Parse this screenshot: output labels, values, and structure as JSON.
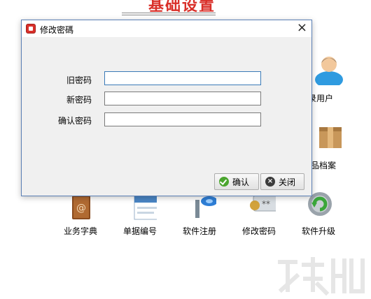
{
  "background": {
    "header_title": "基础设置",
    "tiles": [
      {
        "label": "录用户",
        "icon": "user-icon"
      },
      {
        "label": "品档案",
        "icon": "box-icon"
      },
      {
        "label": "业务字典",
        "icon": "address-book-icon"
      },
      {
        "label": "单据编号",
        "icon": "abc123-icon"
      },
      {
        "label": "软件注册",
        "icon": "key-icon"
      },
      {
        "label": "修改密码",
        "icon": "password-key-icon"
      },
      {
        "label": "软件升级",
        "icon": "gear-update-icon"
      }
    ]
  },
  "dialog": {
    "title": "修改密碼",
    "fields": {
      "old_password": {
        "label": "旧密码",
        "value": ""
      },
      "new_password": {
        "label": "新密码",
        "value": ""
      },
      "confirm_password": {
        "label": "确认密码",
        "value": ""
      }
    },
    "buttons": {
      "confirm": "确认",
      "close": "关闭"
    }
  },
  "colors": {
    "accent": "#d9302a",
    "dialog_border": "#5a7fb5",
    "focus_border": "#3a7ab7"
  }
}
